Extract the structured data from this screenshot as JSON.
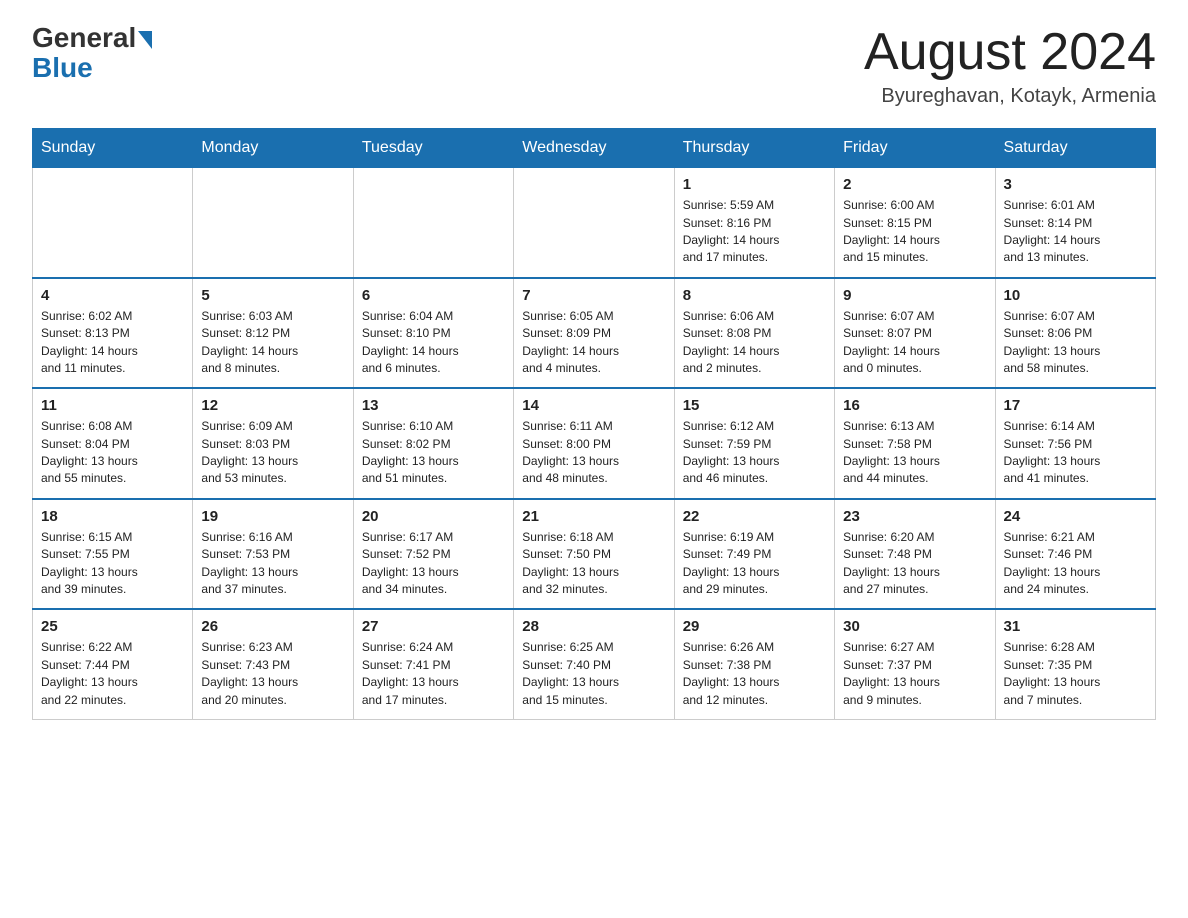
{
  "header": {
    "logo_general": "General",
    "logo_blue": "Blue",
    "month_title": "August 2024",
    "location": "Byureghavan, Kotayk, Armenia"
  },
  "weekdays": [
    "Sunday",
    "Monday",
    "Tuesday",
    "Wednesday",
    "Thursday",
    "Friday",
    "Saturday"
  ],
  "weeks": [
    [
      {
        "day": "",
        "info": ""
      },
      {
        "day": "",
        "info": ""
      },
      {
        "day": "",
        "info": ""
      },
      {
        "day": "",
        "info": ""
      },
      {
        "day": "1",
        "info": "Sunrise: 5:59 AM\nSunset: 8:16 PM\nDaylight: 14 hours\nand 17 minutes."
      },
      {
        "day": "2",
        "info": "Sunrise: 6:00 AM\nSunset: 8:15 PM\nDaylight: 14 hours\nand 15 minutes."
      },
      {
        "day": "3",
        "info": "Sunrise: 6:01 AM\nSunset: 8:14 PM\nDaylight: 14 hours\nand 13 minutes."
      }
    ],
    [
      {
        "day": "4",
        "info": "Sunrise: 6:02 AM\nSunset: 8:13 PM\nDaylight: 14 hours\nand 11 minutes."
      },
      {
        "day": "5",
        "info": "Sunrise: 6:03 AM\nSunset: 8:12 PM\nDaylight: 14 hours\nand 8 minutes."
      },
      {
        "day": "6",
        "info": "Sunrise: 6:04 AM\nSunset: 8:10 PM\nDaylight: 14 hours\nand 6 minutes."
      },
      {
        "day": "7",
        "info": "Sunrise: 6:05 AM\nSunset: 8:09 PM\nDaylight: 14 hours\nand 4 minutes."
      },
      {
        "day": "8",
        "info": "Sunrise: 6:06 AM\nSunset: 8:08 PM\nDaylight: 14 hours\nand 2 minutes."
      },
      {
        "day": "9",
        "info": "Sunrise: 6:07 AM\nSunset: 8:07 PM\nDaylight: 14 hours\nand 0 minutes."
      },
      {
        "day": "10",
        "info": "Sunrise: 6:07 AM\nSunset: 8:06 PM\nDaylight: 13 hours\nand 58 minutes."
      }
    ],
    [
      {
        "day": "11",
        "info": "Sunrise: 6:08 AM\nSunset: 8:04 PM\nDaylight: 13 hours\nand 55 minutes."
      },
      {
        "day": "12",
        "info": "Sunrise: 6:09 AM\nSunset: 8:03 PM\nDaylight: 13 hours\nand 53 minutes."
      },
      {
        "day": "13",
        "info": "Sunrise: 6:10 AM\nSunset: 8:02 PM\nDaylight: 13 hours\nand 51 minutes."
      },
      {
        "day": "14",
        "info": "Sunrise: 6:11 AM\nSunset: 8:00 PM\nDaylight: 13 hours\nand 48 minutes."
      },
      {
        "day": "15",
        "info": "Sunrise: 6:12 AM\nSunset: 7:59 PM\nDaylight: 13 hours\nand 46 minutes."
      },
      {
        "day": "16",
        "info": "Sunrise: 6:13 AM\nSunset: 7:58 PM\nDaylight: 13 hours\nand 44 minutes."
      },
      {
        "day": "17",
        "info": "Sunrise: 6:14 AM\nSunset: 7:56 PM\nDaylight: 13 hours\nand 41 minutes."
      }
    ],
    [
      {
        "day": "18",
        "info": "Sunrise: 6:15 AM\nSunset: 7:55 PM\nDaylight: 13 hours\nand 39 minutes."
      },
      {
        "day": "19",
        "info": "Sunrise: 6:16 AM\nSunset: 7:53 PM\nDaylight: 13 hours\nand 37 minutes."
      },
      {
        "day": "20",
        "info": "Sunrise: 6:17 AM\nSunset: 7:52 PM\nDaylight: 13 hours\nand 34 minutes."
      },
      {
        "day": "21",
        "info": "Sunrise: 6:18 AM\nSunset: 7:50 PM\nDaylight: 13 hours\nand 32 minutes."
      },
      {
        "day": "22",
        "info": "Sunrise: 6:19 AM\nSunset: 7:49 PM\nDaylight: 13 hours\nand 29 minutes."
      },
      {
        "day": "23",
        "info": "Sunrise: 6:20 AM\nSunset: 7:48 PM\nDaylight: 13 hours\nand 27 minutes."
      },
      {
        "day": "24",
        "info": "Sunrise: 6:21 AM\nSunset: 7:46 PM\nDaylight: 13 hours\nand 24 minutes."
      }
    ],
    [
      {
        "day": "25",
        "info": "Sunrise: 6:22 AM\nSunset: 7:44 PM\nDaylight: 13 hours\nand 22 minutes."
      },
      {
        "day": "26",
        "info": "Sunrise: 6:23 AM\nSunset: 7:43 PM\nDaylight: 13 hours\nand 20 minutes."
      },
      {
        "day": "27",
        "info": "Sunrise: 6:24 AM\nSunset: 7:41 PM\nDaylight: 13 hours\nand 17 minutes."
      },
      {
        "day": "28",
        "info": "Sunrise: 6:25 AM\nSunset: 7:40 PM\nDaylight: 13 hours\nand 15 minutes."
      },
      {
        "day": "29",
        "info": "Sunrise: 6:26 AM\nSunset: 7:38 PM\nDaylight: 13 hours\nand 12 minutes."
      },
      {
        "day": "30",
        "info": "Sunrise: 6:27 AM\nSunset: 7:37 PM\nDaylight: 13 hours\nand 9 minutes."
      },
      {
        "day": "31",
        "info": "Sunrise: 6:28 AM\nSunset: 7:35 PM\nDaylight: 13 hours\nand 7 minutes."
      }
    ]
  ]
}
